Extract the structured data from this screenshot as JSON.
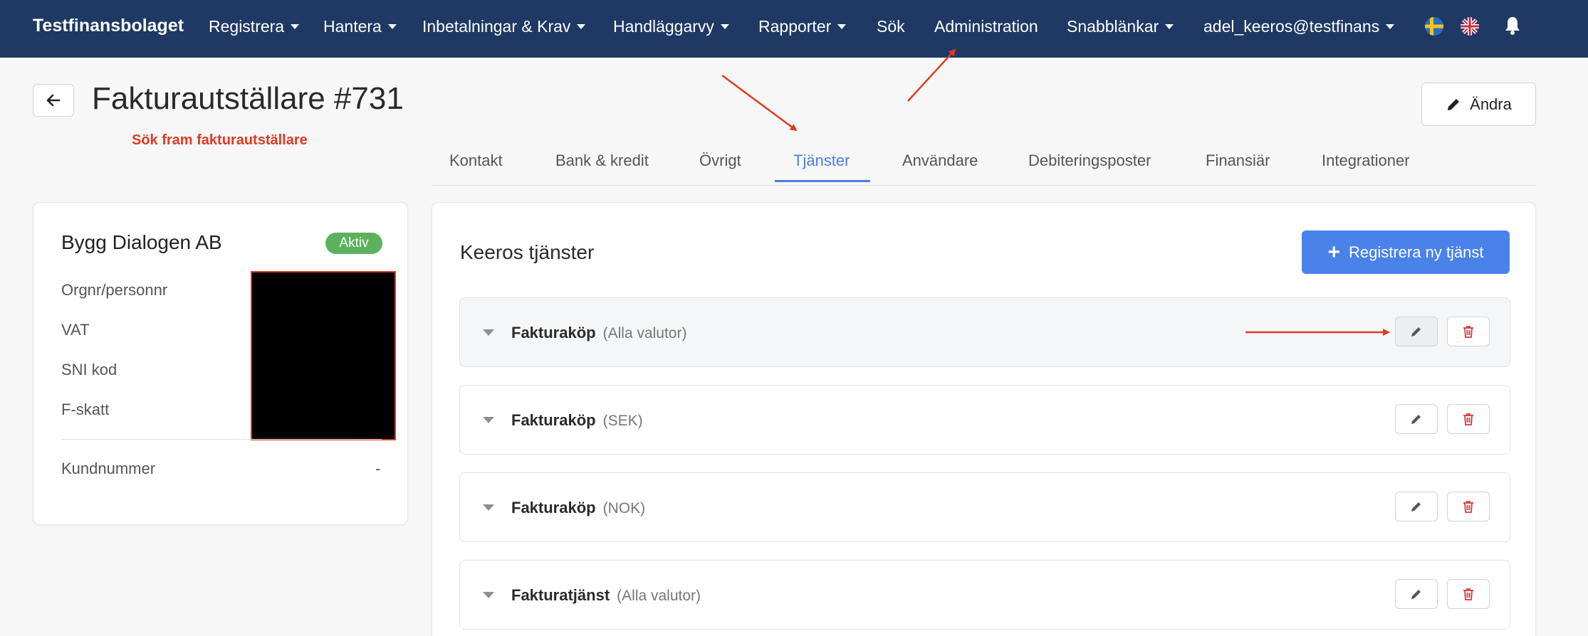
{
  "navbar": {
    "brand": "Testfinansbolaget",
    "items": [
      {
        "label": "Registrera",
        "dropdown": true
      },
      {
        "label": "Hantera",
        "dropdown": true
      },
      {
        "label": "Inbetalningar & Krav",
        "dropdown": true
      },
      {
        "label": "Handläggarvy",
        "dropdown": true
      },
      {
        "label": "Rapporter",
        "dropdown": true
      },
      {
        "label": "Sök",
        "dropdown": false
      },
      {
        "label": "Administration",
        "dropdown": false
      },
      {
        "label": "Snabblänkar",
        "dropdown": true
      },
      {
        "label": "adel_keeros@testfinans",
        "dropdown": true
      }
    ],
    "icons": [
      "swedish-flag-icon",
      "uk-flag-icon",
      "bell-icon"
    ]
  },
  "header": {
    "title": "Fakturautställare #731",
    "annotation": "Sök fram fakturautställare",
    "edit_label": "Ändra"
  },
  "tabs": [
    {
      "label": "Kontakt",
      "active": false
    },
    {
      "label": "Bank & kredit",
      "active": false
    },
    {
      "label": "Övrigt",
      "active": false
    },
    {
      "label": "Tjänster",
      "active": true
    },
    {
      "label": "Användare",
      "active": false
    },
    {
      "label": "Debiteringsposter",
      "active": false
    },
    {
      "label": "Finansiär",
      "active": false
    },
    {
      "label": "Integrationer",
      "active": false
    }
  ],
  "company": {
    "name": "Bygg Dialogen AB",
    "status": "Aktiv",
    "fields": [
      "Orgnr/personnr",
      "VAT",
      "SNI kod",
      "F-skatt"
    ],
    "customer_number_label": "Kundnummer",
    "customer_number": "-"
  },
  "services": {
    "title": "Keeros tjänster",
    "register_label": "Registrera ny tjänst",
    "rows": [
      {
        "name": "Fakturaköp",
        "currency": "(Alla valutor)"
      },
      {
        "name": "Fakturaköp",
        "currency": "(SEK)"
      },
      {
        "name": "Fakturaköp",
        "currency": "(NOK)"
      },
      {
        "name": "Fakturatjänst",
        "currency": "(Alla valutor)"
      }
    ]
  },
  "colors": {
    "navbar": "#1f3964",
    "accent": "#4a82ea",
    "annotation": "#e03a22",
    "status_active": "#5cb25c",
    "delete": "#d9363e"
  }
}
